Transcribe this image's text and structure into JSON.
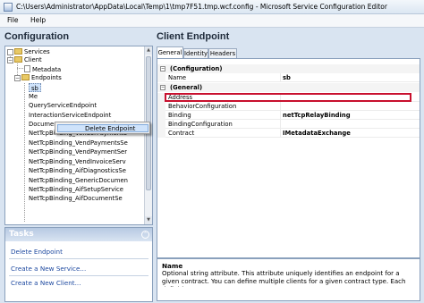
{
  "window": {
    "title": "C:\\Users\\Administrator\\AppData\\Local\\Temp\\1\\tmp7F51.tmp.wcf.config - Microsoft Service Configuration Editor"
  },
  "menu": [
    "File",
    "Help"
  ],
  "left": {
    "heading": "Configuration",
    "tree": {
      "services": "Services",
      "client": "Client",
      "metadata": "Metadata",
      "endpoints": "Endpoints",
      "selected": "sb",
      "items": [
        "Me",
        "QueryServiceEndpoint",
        "InteractionServiceEndpoint",
        "DocumentManagementServiceE",
        "NetTcpBinding_VendorPaymentS",
        "NetTcpBinding_VendPaymentsSe",
        "NetTcpBinding_VendPaymentSer",
        "NetTcpBinding_VendInvoiceServ",
        "NetTcpBinding_AifDiagnosticsSe",
        "NetTcpBinding_GenericDocumen",
        "NetTcpBinding_AifSetupService",
        "NetTcpBinding_AifDocumentSe"
      ]
    },
    "context_menu": {
      "item": "Delete Endpoint"
    },
    "tasks": {
      "heading": "Tasks",
      "links": [
        "Delete Endpoint",
        "Create a New Service...",
        "Create a New Client..."
      ]
    }
  },
  "right": {
    "heading": "Client Endpoint",
    "tabs": [
      "General",
      "Identity",
      "Headers"
    ],
    "active_tab": "General",
    "grid": {
      "cat1": "(Configuration)",
      "cat2": "(General)",
      "rows1": [
        {
          "name": "Name",
          "value": "sb"
        }
      ],
      "rows2": [
        {
          "name": "Address",
          "value": ""
        },
        {
          "name": "BehaviorConfiguration",
          "value": ""
        },
        {
          "name": "Binding",
          "value": "netTcpRelayBinding"
        },
        {
          "name": "BindingConfiguration",
          "value": ""
        },
        {
          "name": "Contract",
          "value": "IMetadataExchange"
        }
      ]
    },
    "description": {
      "name": "Name",
      "text": "Optional string attribute. This attribute uniquely identifies an endpoint for a given contract. You can define multiple clients for a given contract type. Each definition mus..."
    }
  },
  "colors": {
    "highlight_border": "#c8102e",
    "link": "#1f4aa0",
    "background": "#d9e4f1"
  }
}
